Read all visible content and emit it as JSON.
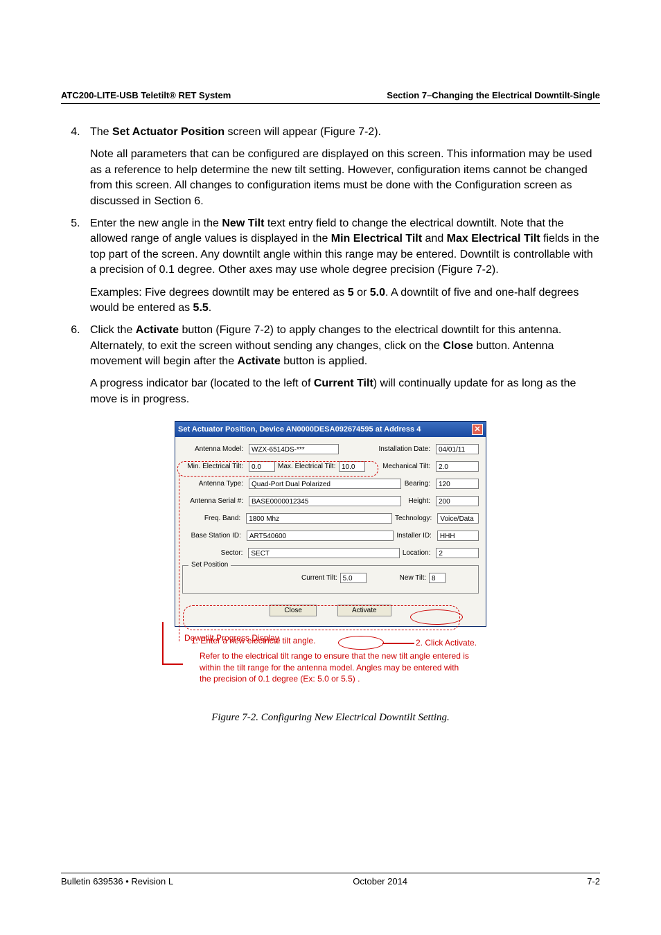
{
  "header": {
    "left": "ATC200-LITE-USB Teletilt® RET System",
    "right": "Section 7–Changing the Electrical Downtilt-Single"
  },
  "steps": {
    "s4": {
      "p1a": "The ",
      "p1b": "Set Actuator Position",
      "p1c": " screen will appear (Figure 7-2).",
      "p2": "Note all parameters that can be configured are displayed on this screen. This information may be used as a reference to help determine the new tilt setting. However, configuration items cannot be changed from this screen. All changes to configuration items must be done with the Configuration screen as discussed in Section 6."
    },
    "s5": {
      "p1a": "Enter the new angle in the ",
      "p1b": "New Tilt",
      "p1c": " text entry field to change the electrical downtilt. Note that the allowed range of angle values is displayed in the ",
      "p1d": "Min Electrical Tilt",
      "p1e": " and ",
      "p1f": "Max Electrical Tilt",
      "p1g": " fields in the top part of the screen. Any downtilt angle within this range may be entered. Downtilt is controllable with a precision of 0.1 degree. Other axes may use whole degree precision (Figure 7-2).",
      "p2a": "Examples: Five degrees downtilt may be entered as ",
      "p2b": "5",
      "p2c": " or ",
      "p2d": "5.0",
      "p2e": ". A downtilt of five and one-half degrees would be entered as ",
      "p2f": "5.5",
      "p2g": "."
    },
    "s6": {
      "p1a": "Click the ",
      "p1b": "Activate",
      "p1c": " button (Figure 7-2) to apply changes to the electrical downtilt for this antenna. Alternately, to exit the screen without sending any changes, click on the ",
      "p1d": "Close",
      "p1e": " button. Antenna movement will begin after the ",
      "p1f": "Activate",
      "p1g": " button is applied.",
      "p2a": "A progress indicator bar (located to the left of ",
      "p2b": "Current Tilt",
      "p2c": ") will continually update for as long as the move is in progress."
    }
  },
  "dialog": {
    "title": "Set Actuator Position, Device AN0000DESA092674595 at Address 4",
    "labels": {
      "antenna_model": "Antenna Model:",
      "installation_date": "Installation Date:",
      "min_tilt": "Min. Electrical Tilt:",
      "max_tilt": "Max. Electrical Tilt:",
      "mech_tilt": "Mechanical Tilt:",
      "antenna_type": "Antenna Type:",
      "bearing": "Bearing:",
      "antenna_serial": "Antenna Serial #:",
      "height": "Height:",
      "freq_band": "Freq. Band:",
      "technology": "Technology:",
      "base_station": "Base Station ID:",
      "installer": "Installer ID:",
      "sector": "Sector:",
      "location": "Location:",
      "set_position": "Set Position",
      "current_tilt": "Current Tilt:",
      "new_tilt": "New Tilt:"
    },
    "values": {
      "antenna_model": "WZX-6514DS-***",
      "installation_date": "04/01/11",
      "min_tilt": "0.0",
      "max_tilt": "10.0",
      "mech_tilt": "2.0",
      "antenna_type": "Quad-Port Dual Polarized",
      "bearing": "120",
      "antenna_serial": "BASE0000012345",
      "height": "200",
      "freq_band": "1800  Mhz",
      "technology": "Voice/Data",
      "base_station": "ART540600",
      "installer": "HHH",
      "sector": "SECT",
      "location": "2",
      "current_tilt": "5.0",
      "new_tilt": "8"
    },
    "buttons": {
      "close": "Close",
      "activate": "Activate"
    }
  },
  "annotations": {
    "progress": "Downtilt Progress Display.",
    "activate": "2. Click Activate.",
    "step1": "1.  Enter a new electrical tilt angle.",
    "note": "Refer to the electrical tilt range to ensure that the new tilt angle entered is within the tilt range for the antenna model. Angles may be entered with the precision of 0.1 degree (Ex: 5.0 or 5.5) ."
  },
  "caption": "Figure 7-2. Configuring New Electrical Downtilt Setting.",
  "footer": {
    "left": "Bulletin 639536   •   Revision L",
    "center": "October 2014",
    "right": "7-2"
  }
}
